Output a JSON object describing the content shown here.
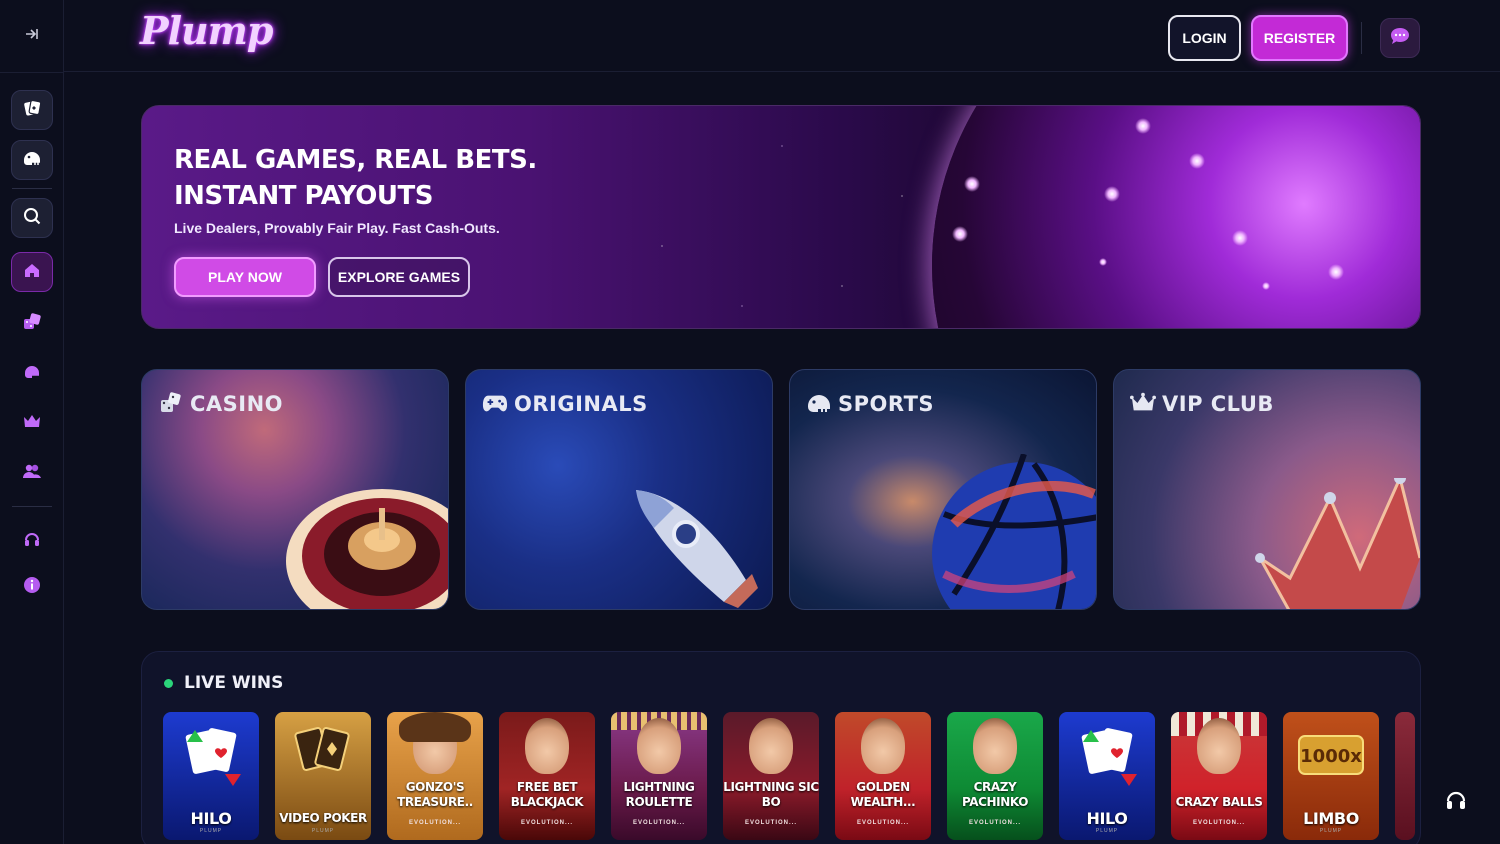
{
  "brand": {
    "logo_text": "Plump",
    "accent": "#c32ad6",
    "live_dot": "#2bd47a"
  },
  "header": {
    "login_label": "LOGIN",
    "register_label": "REGISTER"
  },
  "sidebar": {
    "items": [
      {
        "name": "cards-icon"
      },
      {
        "name": "helmet-icon"
      },
      {
        "name": "search-icon"
      },
      {
        "name": "home-icon",
        "active": true
      },
      {
        "name": "dice-icon"
      },
      {
        "name": "sports-icon"
      },
      {
        "name": "crown-icon"
      },
      {
        "name": "users-icon"
      },
      {
        "name": "headset-icon"
      },
      {
        "name": "info-icon"
      }
    ]
  },
  "hero": {
    "title_line1": "REAL GAMES, REAL BETS.",
    "title_line2": "INSTANT PAYOUTS",
    "subtitle": "Live Dealers, Provably Fair Play. Fast Cash-Outs.",
    "play_label": "PLAY NOW",
    "explore_label": "EXPLORE GAMES"
  },
  "categories": [
    {
      "label": "CASINO",
      "icon": "dice-icon"
    },
    {
      "label": "ORIGINALS",
      "icon": "gamepad-icon"
    },
    {
      "label": "SPORTS",
      "icon": "helmet-icon"
    },
    {
      "label": "VIP CLUB",
      "icon": "crown-icon"
    }
  ],
  "live_wins": {
    "title": "LIVE WINS",
    "games": [
      {
        "name": "HILO",
        "provider": "PLUMP"
      },
      {
        "name": "VIDEO POKER",
        "provider": "PLUMP"
      },
      {
        "name": "GONZO'S TREASURE..",
        "provider": "EVOLUTION..."
      },
      {
        "name": "FREE BET BLACKJACK",
        "provider": "EVOLUTION..."
      },
      {
        "name": "LIGHTNING ROULETTE",
        "provider": "EVOLUTION..."
      },
      {
        "name": "LIGHTNING SIC BO",
        "provider": "EVOLUTION..."
      },
      {
        "name": "GOLDEN WEALTH...",
        "provider": "EVOLUTION..."
      },
      {
        "name": "CRAZY PACHINKO",
        "provider": "EVOLUTION..."
      },
      {
        "name": "HILO",
        "provider": "PLUMP"
      },
      {
        "name": "CRAZY BALLS",
        "provider": "EVOLUTION..."
      },
      {
        "name": "LIMBO",
        "provider": "PLUMP"
      }
    ]
  }
}
